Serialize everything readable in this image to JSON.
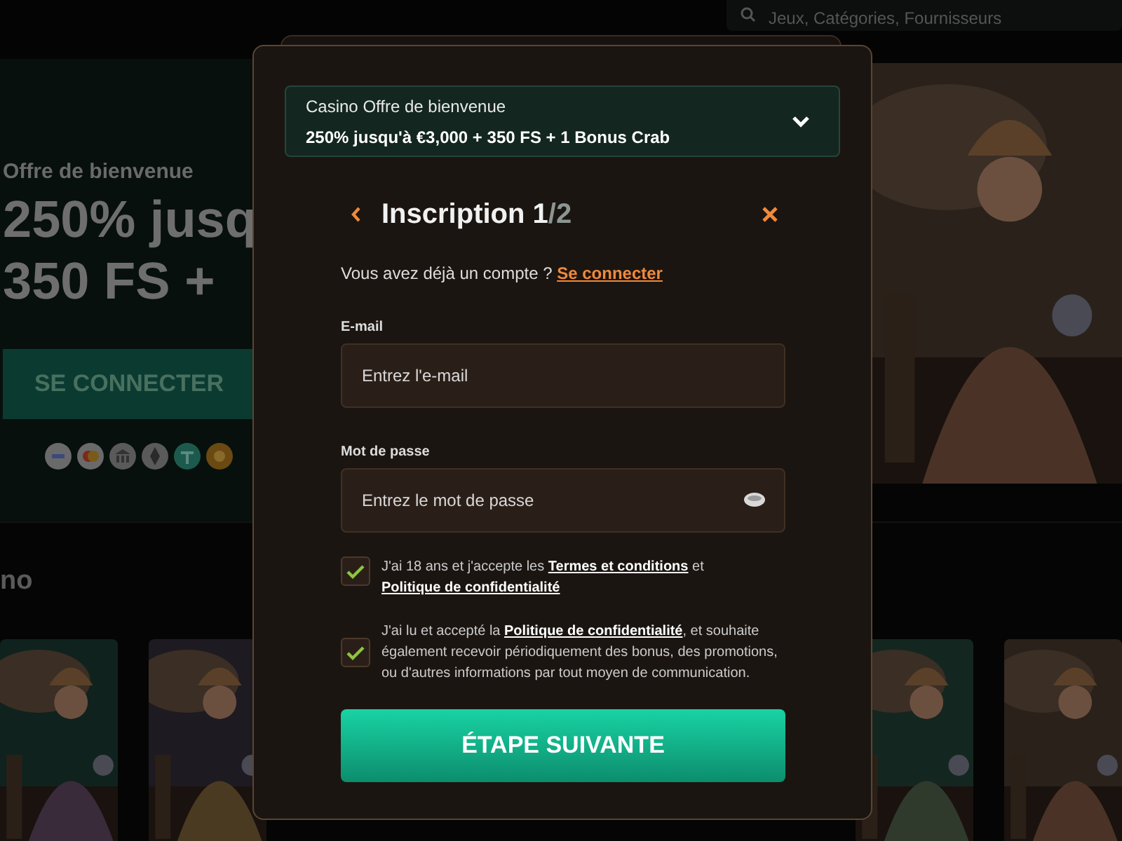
{
  "background": {
    "search": {
      "placeholder": "Jeux, Catégories, Fournisseurs"
    },
    "hero": {
      "subtitle": "Offre de bienvenue",
      "title_lines": [
        "250% jusq",
        "350 FS +"
      ],
      "button": "SE CONNECTER",
      "payment_methods": [
        {
          "kind": "visa"
        },
        {
          "kind": "mastercard"
        },
        {
          "kind": "bank"
        },
        {
          "kind": "ethereum"
        },
        {
          "kind": "tether"
        },
        {
          "kind": "bitcoin"
        }
      ]
    },
    "section_title": "no"
  },
  "modal": {
    "offer": {
      "title": "Casino Offre de bienvenue",
      "text": "250% jusqu'à €3,000 + 350 FS + 1 Bonus Crab",
      "expanded": false
    },
    "heading": {
      "title": "Inscription 1",
      "step_total": "/2"
    },
    "login_prompt": {
      "text": "Vous avez déjà un compte ?",
      "link": "Se connecter"
    },
    "fields": [
      {
        "kind": "email",
        "label": "E-mail",
        "placeholder": "Entrez l'e-mail"
      },
      {
        "kind": "password",
        "label": "Mot de passe",
        "placeholder": "Entrez le mot de passe"
      }
    ],
    "consents": [
      {
        "checked": true,
        "parts": [
          {
            "text": "J'ai 18 ans et j'accepte les ",
            "kind": "text"
          },
          {
            "text": "Termes et conditions",
            "kind": "link"
          },
          {
            "text": " et ",
            "kind": "text"
          },
          {
            "text": "Politique de confidentialité",
            "kind": "link"
          }
        ]
      },
      {
        "checked": true,
        "parts": [
          {
            "text": "J'ai lu et accepté la ",
            "kind": "text"
          },
          {
            "text": "Politique de confidentialité",
            "kind": "link"
          },
          {
            "text": ", et souhaite également recevoir périodiquement des bonus, des promotions, ou d'autres informations par tout moyen de communication.",
            "kind": "text"
          }
        ]
      }
    ],
    "submit": "ÉTAPE SUIVANTE"
  }
}
